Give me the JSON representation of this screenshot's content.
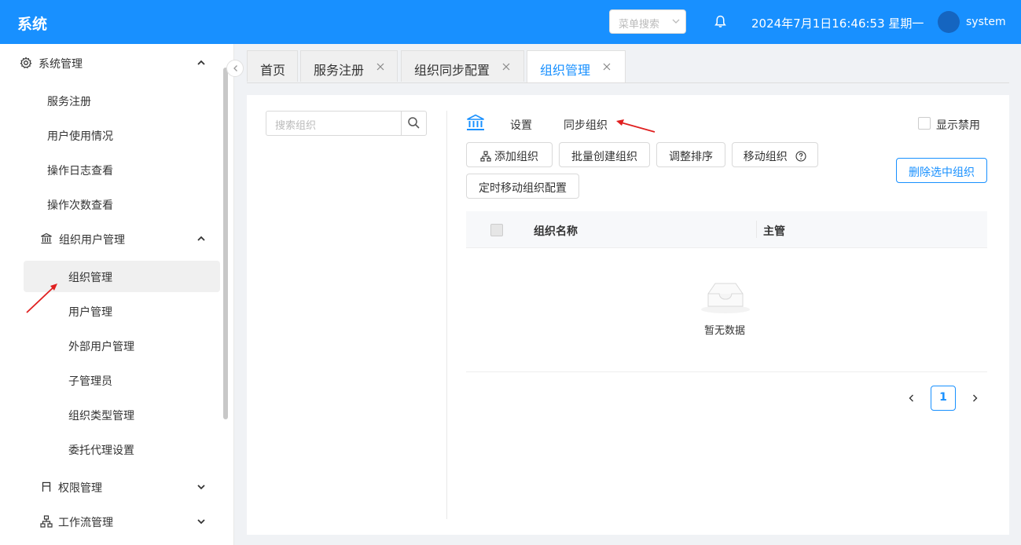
{
  "header": {
    "title": "系统",
    "menu_search_placeholder": "菜单搜索",
    "datetime": "2024年7月1日16:46:53 星期一",
    "username": "system",
    "bg_color": "#1890ff"
  },
  "sidebar": {
    "group_label": "系统管理",
    "items": [
      {
        "label": "服务注册"
      },
      {
        "label": "用户使用情况"
      },
      {
        "label": "操作日志查看"
      },
      {
        "label": "操作次数查看"
      }
    ],
    "subgroup_label": "组织用户管理",
    "subitems": [
      {
        "label": "组织管理"
      },
      {
        "label": "用户管理"
      },
      {
        "label": "外部用户管理"
      },
      {
        "label": "子管理员"
      },
      {
        "label": "组织类型管理"
      },
      {
        "label": "委托代理设置"
      }
    ],
    "perm_label": "权限管理",
    "workflow_label": "工作流管理"
  },
  "tabs": [
    {
      "label": "首页"
    },
    {
      "label": "服务注册"
    },
    {
      "label": "组织同步配置"
    },
    {
      "label": "组织管理"
    }
  ],
  "main": {
    "tree_search_placeholder": "搜索组织",
    "settings_link": "设置",
    "sync_link": "同步组织",
    "show_disabled_label": "显示禁用",
    "buttons": {
      "add": "添加组织",
      "batch_create": "批量创建组织",
      "adjust_order": "调整排序",
      "move": "移动组织",
      "timed_move": "定时移动组织配置",
      "delete_selected": "删除选中组织"
    },
    "table": {
      "columns": [
        "组织名称",
        "主管"
      ],
      "empty_text": "暂无数据"
    },
    "pagination": {
      "current_page": "1"
    }
  }
}
